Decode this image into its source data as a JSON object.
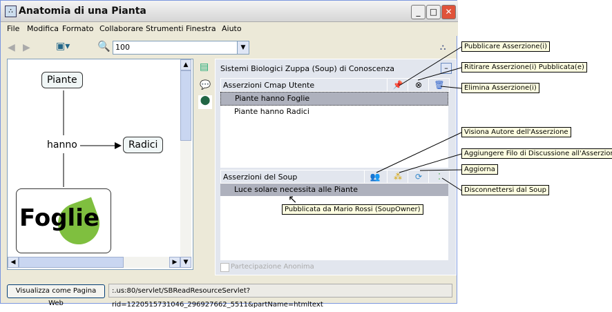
{
  "window": {
    "title": "Anatomia di una Pianta"
  },
  "menu": [
    "File",
    "Modifica",
    "Formato",
    "Collaborare",
    "Strumenti",
    "Finestra",
    "Aiuto"
  ],
  "toolbar": {
    "zoom_value": "100"
  },
  "map": {
    "nodes": {
      "piante": "Piante",
      "hanno": "hanno",
      "radici": "Radici",
      "foglie": "Foglie"
    }
  },
  "soup": {
    "title": "Sistemi Biologici Zuppa (Soup) di Conoscenza",
    "user_section": {
      "header": "Asserzioni Cmap Utente",
      "items": [
        "Piante hanno Foglie",
        "Piante hanno Radici"
      ]
    },
    "soup_section": {
      "header": "Asserzioni del Soup",
      "items": [
        "Luce solare necessita alle Piante"
      ]
    },
    "tooltip": "Pubblicata da Mario Rossi  (SoupOwner)",
    "anonymous_label": "Partecipazione Anonima",
    "anonymous_checked": false
  },
  "callouts": {
    "publish": "Pubblicare Asserzione(i)",
    "retract": "Ritirare Asserzione(i) Pubblicata(e)",
    "delete": "Elimina Asserzione(i)",
    "author": "Visiona Autore dell'Asserzione",
    "thread": "Aggiungere Filo di Discussione all'Asserzione",
    "refresh": "Aggiorna",
    "disconnect": "Disconnettersi dal Soup"
  },
  "statusbar": {
    "web_button": "Visualizza come Pagina Web",
    "url": ":.us:80/servlet/SBReadResourceServlet?rid=1220515731046_296927662_5511&partName=htmltext"
  }
}
